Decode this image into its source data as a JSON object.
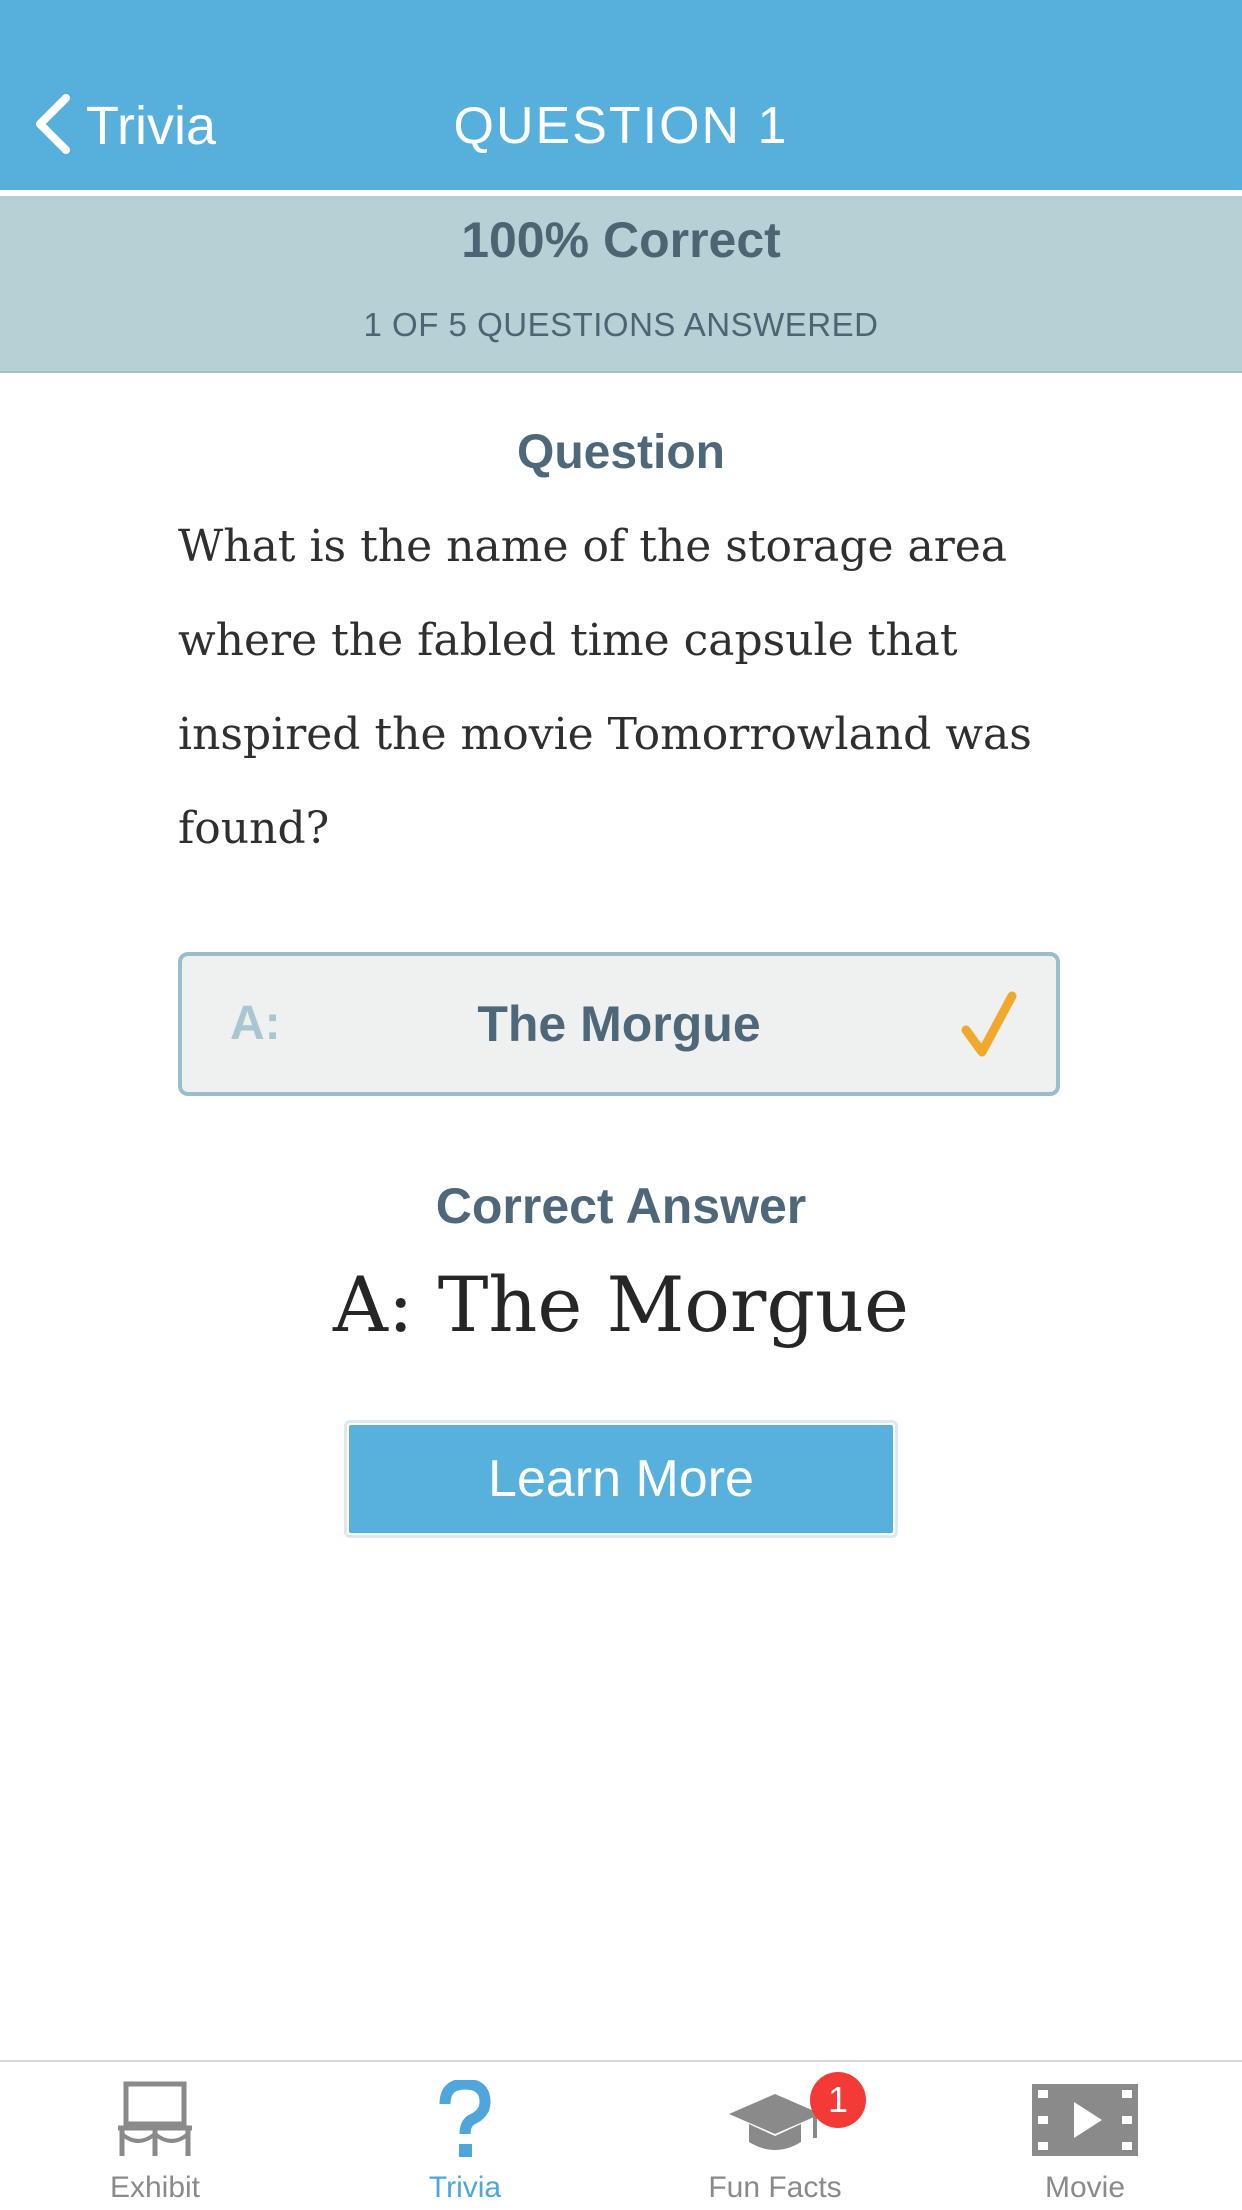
{
  "nav": {
    "back_label": "Trivia",
    "title": "QUESTION 1"
  },
  "score": {
    "percent_text": "100% Correct",
    "progress_text": "1 OF 5 QUESTIONS ANSWERED"
  },
  "question": {
    "heading": "Question",
    "text": "What is the name of the storage area where the fabled time capsule that inspired the movie Tomorrowland was found?"
  },
  "answer_option": {
    "letter": "A:",
    "text": "The Morgue",
    "state": "correct",
    "icon": "checkmark-icon"
  },
  "correct_answer": {
    "heading": "Correct Answer",
    "value": "A: The Morgue"
  },
  "learn_more_label": "Learn More",
  "tabbar": {
    "items": [
      {
        "label": "Exhibit",
        "icon": "exhibit-icon",
        "active": false
      },
      {
        "label": "Trivia",
        "icon": "question-mark-icon",
        "active": true
      },
      {
        "label": "Fun Facts",
        "icon": "graduation-cap-icon",
        "active": false,
        "badge": "1"
      },
      {
        "label": "Movie",
        "icon": "film-play-icon",
        "active": false
      }
    ]
  },
  "colors": {
    "nav_blue": "#57b0dc",
    "score_band": "#b6d0d5",
    "heading_slate": "#4f6879",
    "check_orange": "#f0a92d",
    "badge_red": "#f33a36",
    "tab_active": "#4ea6da",
    "tab_inactive": "#8a8a8a"
  }
}
